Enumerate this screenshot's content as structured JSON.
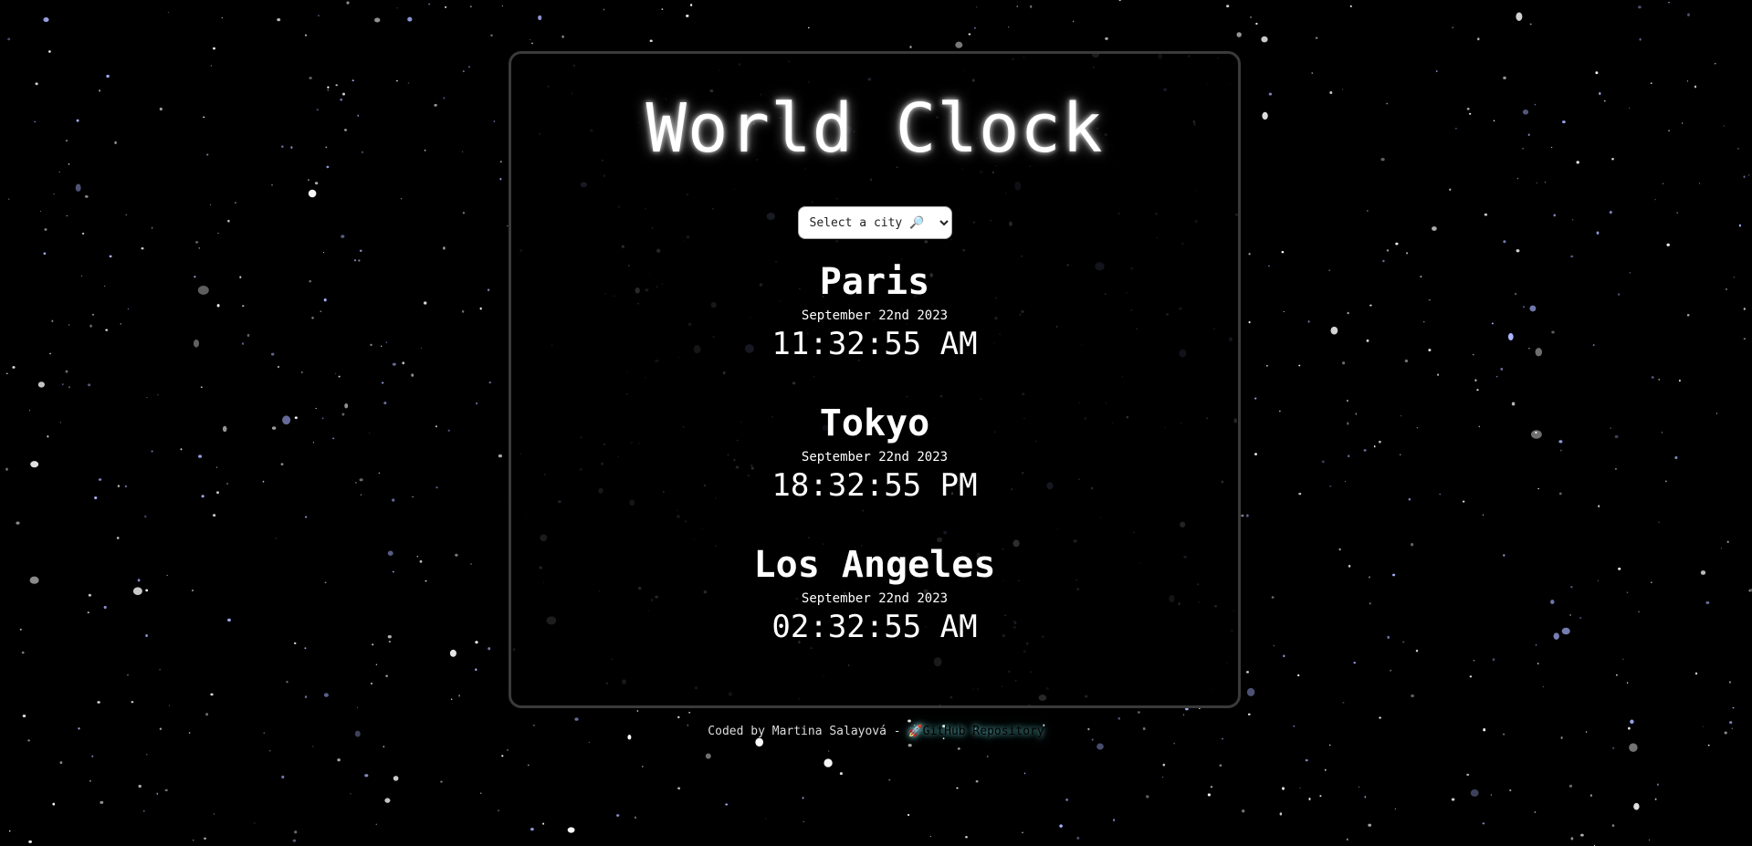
{
  "title": "World Clock",
  "select": {
    "selected": "Select a city 🔎"
  },
  "cities": [
    {
      "name": "Paris",
      "date": "September 22nd 2023",
      "time": "11:32:55 AM"
    },
    {
      "name": "Tokyo",
      "date": "September 22nd 2023",
      "time": "18:32:55 PM"
    },
    {
      "name": "Los Angeles",
      "date": "September 22nd 2023",
      "time": "02:32:55 AM"
    }
  ],
  "footer": {
    "credit": "Coded by Martina Salayová - ",
    "link_icon": "rocket-icon",
    "link_emoji": "🚀",
    "link_label": "GitHub Repository"
  },
  "colors": {
    "background": "#000000",
    "card_border": "#3a3a3a",
    "text": "#ffffff"
  }
}
